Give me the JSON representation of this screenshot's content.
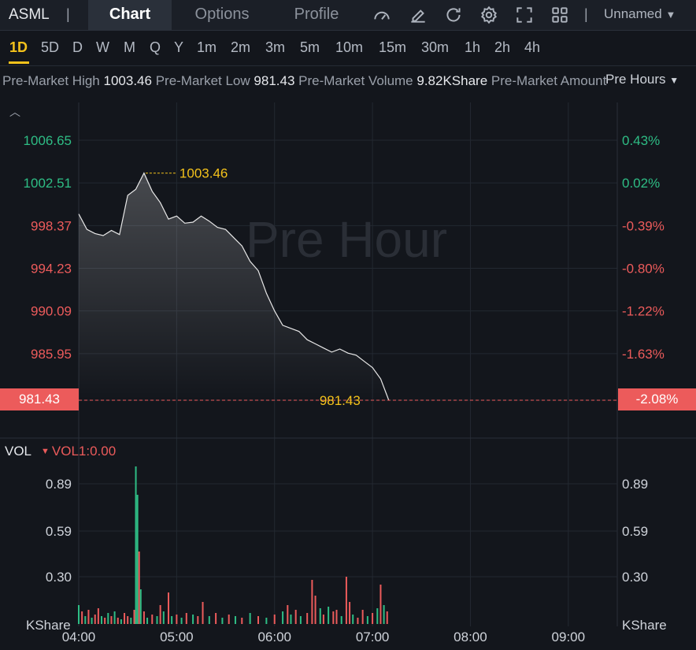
{
  "header": {
    "ticker": "ASML",
    "separator": "|",
    "tabs": [
      "Chart",
      "Options",
      "Profile"
    ],
    "active_tab": "Chart",
    "icons": [
      "speedometer-icon",
      "edit-icon",
      "refresh-icon",
      "settings-gear-icon",
      "fullscreen-icon",
      "grid-layout-icon"
    ],
    "layout_name": "Unnamed"
  },
  "periods": {
    "items": [
      "1D",
      "5D",
      "D",
      "W",
      "M",
      "Q",
      "Y",
      "1m",
      "2m",
      "3m",
      "5m",
      "10m",
      "15m",
      "30m",
      "1h",
      "2h",
      "4h"
    ],
    "active": "1D",
    "session_selector": "Pre Hours"
  },
  "info_bar": {
    "high_label": "Pre-Market High",
    "high_value": "1003.46",
    "low_label": "Pre-Market Low",
    "low_value": "981.43",
    "volume_label": "Pre-Market Volume",
    "volume_value": "9.82KShare",
    "amount_label": "Pre-Market Amount"
  },
  "chart_data": {
    "type": "line",
    "watermark": "Pre Hour",
    "price_axis_left": [
      "1006.65",
      "1002.51",
      "998.37",
      "994.23",
      "990.09",
      "985.95"
    ],
    "percent_axis_right": [
      "0.43%",
      "0.02%",
      "-0.39%",
      "-0.80%",
      "-1.22%",
      "-1.63%"
    ],
    "last_price": "981.43",
    "last_percent": "-2.08%",
    "high_marker": "1003.46",
    "low_marker": "981.43",
    "time_axis": [
      "04:00",
      "05:00",
      "06:00",
      "07:00",
      "08:00",
      "09:00"
    ],
    "ylim": [
      981.43,
      1006.65
    ],
    "series": [
      {
        "x": [
          "04:00",
          "04:05",
          "04:10",
          "04:15",
          "04:20",
          "04:25",
          "04:30",
          "04:35",
          "04:40",
          "04:45",
          "04:50",
          "04:55",
          "05:00",
          "05:05",
          "05:10",
          "05:15",
          "05:20",
          "05:25",
          "05:30",
          "05:35",
          "05:40",
          "05:45",
          "05:50",
          "05:55",
          "06:00",
          "06:05",
          "06:10",
          "06:15",
          "06:20",
          "06:25",
          "06:30",
          "06:35",
          "06:40",
          "06:45",
          "06:50",
          "06:55",
          "07:00",
          "07:05",
          "07:10"
        ],
        "values": [
          999.5,
          998.0,
          997.6,
          997.4,
          997.9,
          997.5,
          1001.3,
          1001.9,
          1003.46,
          1001.7,
          1000.6,
          999.0,
          999.3,
          998.6,
          998.7,
          999.3,
          998.8,
          998.2,
          998.0,
          997.2,
          996.4,
          994.9,
          994.0,
          991.8,
          990.1,
          988.7,
          988.4,
          988.1,
          987.3,
          986.9,
          986.5,
          986.1,
          986.4,
          986.0,
          985.8,
          985.2,
          984.6,
          983.5,
          981.43
        ]
      }
    ],
    "volume": {
      "label": "VOL",
      "indicator": "VOL1:0.00",
      "axis_left": [
        "0.89",
        "0.59",
        "0.30"
      ],
      "axis_right": [
        "0.89",
        "0.59",
        "0.30"
      ],
      "unit": "KShare",
      "bars": [
        {
          "t": "04:00",
          "v": 0.12,
          "up": true
        },
        {
          "t": "04:02",
          "v": 0.08,
          "up": false
        },
        {
          "t": "04:04",
          "v": 0.05,
          "up": true
        },
        {
          "t": "04:06",
          "v": 0.09,
          "up": false
        },
        {
          "t": "04:08",
          "v": 0.04,
          "up": true
        },
        {
          "t": "04:10",
          "v": 0.06,
          "up": false
        },
        {
          "t": "04:12",
          "v": 0.1,
          "up": false
        },
        {
          "t": "04:14",
          "v": 0.05,
          "up": true
        },
        {
          "t": "04:16",
          "v": 0.04,
          "up": false
        },
        {
          "t": "04:18",
          "v": 0.07,
          "up": true
        },
        {
          "t": "04:20",
          "v": 0.05,
          "up": false
        },
        {
          "t": "04:22",
          "v": 0.08,
          "up": true
        },
        {
          "t": "04:24",
          "v": 0.04,
          "up": false
        },
        {
          "t": "04:26",
          "v": 0.03,
          "up": true
        },
        {
          "t": "04:28",
          "v": 0.07,
          "up": false
        },
        {
          "t": "04:30",
          "v": 0.05,
          "up": false
        },
        {
          "t": "04:32",
          "v": 0.04,
          "up": true
        },
        {
          "t": "04:34",
          "v": 0.09,
          "up": false
        },
        {
          "t": "04:35",
          "v": 1.0,
          "up": true
        },
        {
          "t": "04:36",
          "v": 0.82,
          "up": true
        },
        {
          "t": "04:37",
          "v": 0.46,
          "up": false
        },
        {
          "t": "04:38",
          "v": 0.22,
          "up": true
        },
        {
          "t": "04:40",
          "v": 0.08,
          "up": false
        },
        {
          "t": "04:42",
          "v": 0.04,
          "up": true
        },
        {
          "t": "04:45",
          "v": 0.06,
          "up": false
        },
        {
          "t": "04:48",
          "v": 0.05,
          "up": true
        },
        {
          "t": "04:50",
          "v": 0.12,
          "up": false
        },
        {
          "t": "04:52",
          "v": 0.08,
          "up": true
        },
        {
          "t": "04:55",
          "v": 0.2,
          "up": false
        },
        {
          "t": "04:57",
          "v": 0.05,
          "up": true
        },
        {
          "t": "05:00",
          "v": 0.06,
          "up": false
        },
        {
          "t": "05:03",
          "v": 0.04,
          "up": true
        },
        {
          "t": "05:06",
          "v": 0.07,
          "up": false
        },
        {
          "t": "05:10",
          "v": 0.06,
          "up": true
        },
        {
          "t": "05:13",
          "v": 0.05,
          "up": false
        },
        {
          "t": "05:16",
          "v": 0.14,
          "up": false
        },
        {
          "t": "05:20",
          "v": 0.05,
          "up": true
        },
        {
          "t": "05:24",
          "v": 0.07,
          "up": false
        },
        {
          "t": "05:28",
          "v": 0.04,
          "up": true
        },
        {
          "t": "05:32",
          "v": 0.06,
          "up": false
        },
        {
          "t": "05:36",
          "v": 0.05,
          "up": true
        },
        {
          "t": "05:40",
          "v": 0.04,
          "up": false
        },
        {
          "t": "05:45",
          "v": 0.07,
          "up": true
        },
        {
          "t": "05:50",
          "v": 0.05,
          "up": false
        },
        {
          "t": "05:55",
          "v": 0.04,
          "up": true
        },
        {
          "t": "06:00",
          "v": 0.06,
          "up": false
        },
        {
          "t": "06:05",
          "v": 0.08,
          "up": true
        },
        {
          "t": "06:08",
          "v": 0.12,
          "up": false
        },
        {
          "t": "06:10",
          "v": 0.06,
          "up": true
        },
        {
          "t": "06:13",
          "v": 0.09,
          "up": false
        },
        {
          "t": "06:16",
          "v": 0.05,
          "up": true
        },
        {
          "t": "06:20",
          "v": 0.07,
          "up": false
        },
        {
          "t": "06:23",
          "v": 0.28,
          "up": false
        },
        {
          "t": "06:25",
          "v": 0.18,
          "up": false
        },
        {
          "t": "06:28",
          "v": 0.1,
          "up": true
        },
        {
          "t": "06:30",
          "v": 0.06,
          "up": false
        },
        {
          "t": "06:33",
          "v": 0.11,
          "up": true
        },
        {
          "t": "06:36",
          "v": 0.08,
          "up": false
        },
        {
          "t": "06:38",
          "v": 0.09,
          "up": false
        },
        {
          "t": "06:41",
          "v": 0.05,
          "up": true
        },
        {
          "t": "06:44",
          "v": 0.3,
          "up": false
        },
        {
          "t": "06:46",
          "v": 0.14,
          "up": false
        },
        {
          "t": "06:48",
          "v": 0.06,
          "up": true
        },
        {
          "t": "06:51",
          "v": 0.04,
          "up": false
        },
        {
          "t": "06:54",
          "v": 0.09,
          "up": false
        },
        {
          "t": "06:57",
          "v": 0.05,
          "up": true
        },
        {
          "t": "07:00",
          "v": 0.07,
          "up": false
        },
        {
          "t": "07:03",
          "v": 0.1,
          "up": true
        },
        {
          "t": "07:05",
          "v": 0.25,
          "up": false
        },
        {
          "t": "07:07",
          "v": 0.12,
          "up": true
        },
        {
          "t": "07:09",
          "v": 0.08,
          "up": false
        }
      ]
    }
  },
  "colors": {
    "up": "#2ebd85",
    "down": "#ec5b5b",
    "accent": "#f4c21b"
  }
}
